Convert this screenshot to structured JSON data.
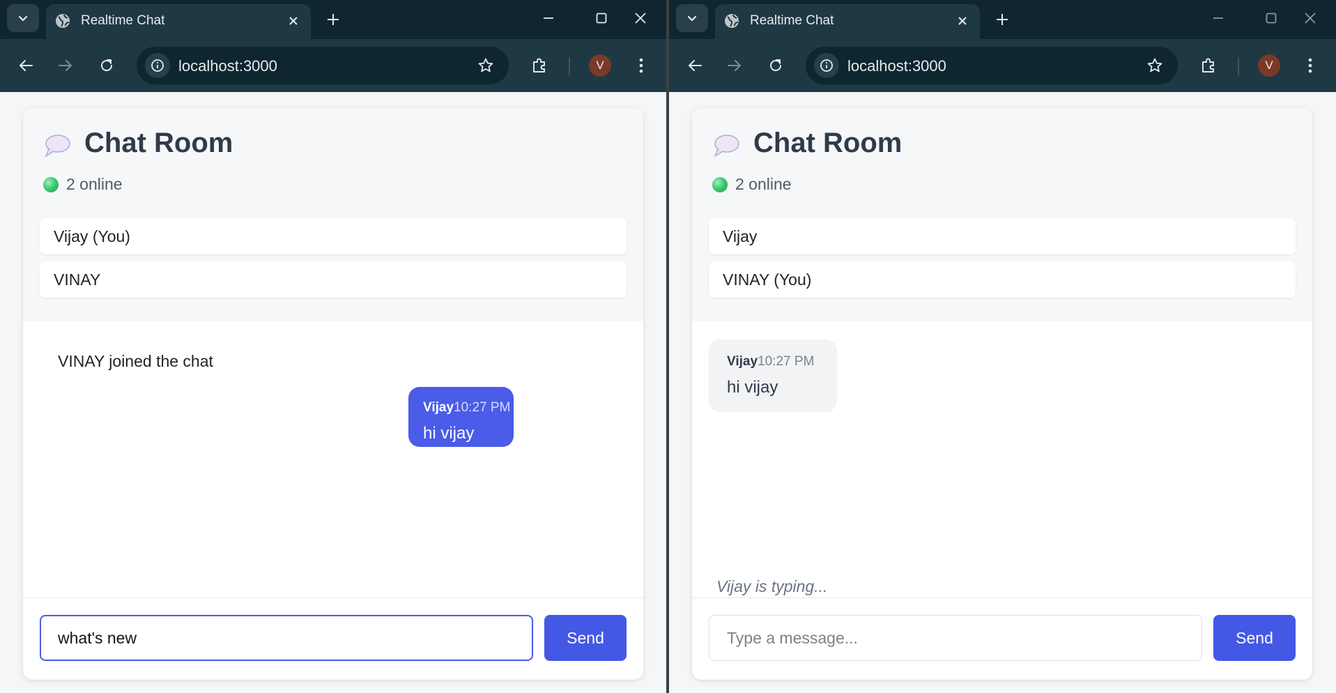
{
  "windows": [
    {
      "tab_title": "Realtime Chat",
      "url": "localhost:3000",
      "profile_initial": "V",
      "room_title": "Chat Room",
      "online_text": "2 online",
      "users": [
        "Vijay (You)",
        "VINAY"
      ],
      "system_message": "VINAY joined the chat",
      "bubble": {
        "sender": "Vijay",
        "time": "10:27 PM",
        "text": "hi vijay"
      },
      "typing_text": "",
      "input_value": "what's new",
      "input_placeholder": "",
      "send_label": "Send"
    },
    {
      "tab_title": "Realtime Chat",
      "url": "localhost:3000",
      "profile_initial": "V",
      "room_title": "Chat Room",
      "online_text": "2 online",
      "users": [
        "Vijay",
        "VINAY (You)"
      ],
      "system_message": "",
      "bubble": {
        "sender": "Vijay",
        "time": "10:27 PM",
        "text": "hi vijay"
      },
      "typing_text": "Vijay is typing...",
      "input_value": "",
      "input_placeholder": "Type a message...",
      "send_label": "Send"
    }
  ],
  "colors": {
    "accent": "#4458e6",
    "own_bubble": "#4a5ce8",
    "other_bubble": "#f2f3f5",
    "chrome_dark": "#0f2630",
    "chrome_toolbar": "#1e3944",
    "online_dot": "#3ccb74"
  }
}
